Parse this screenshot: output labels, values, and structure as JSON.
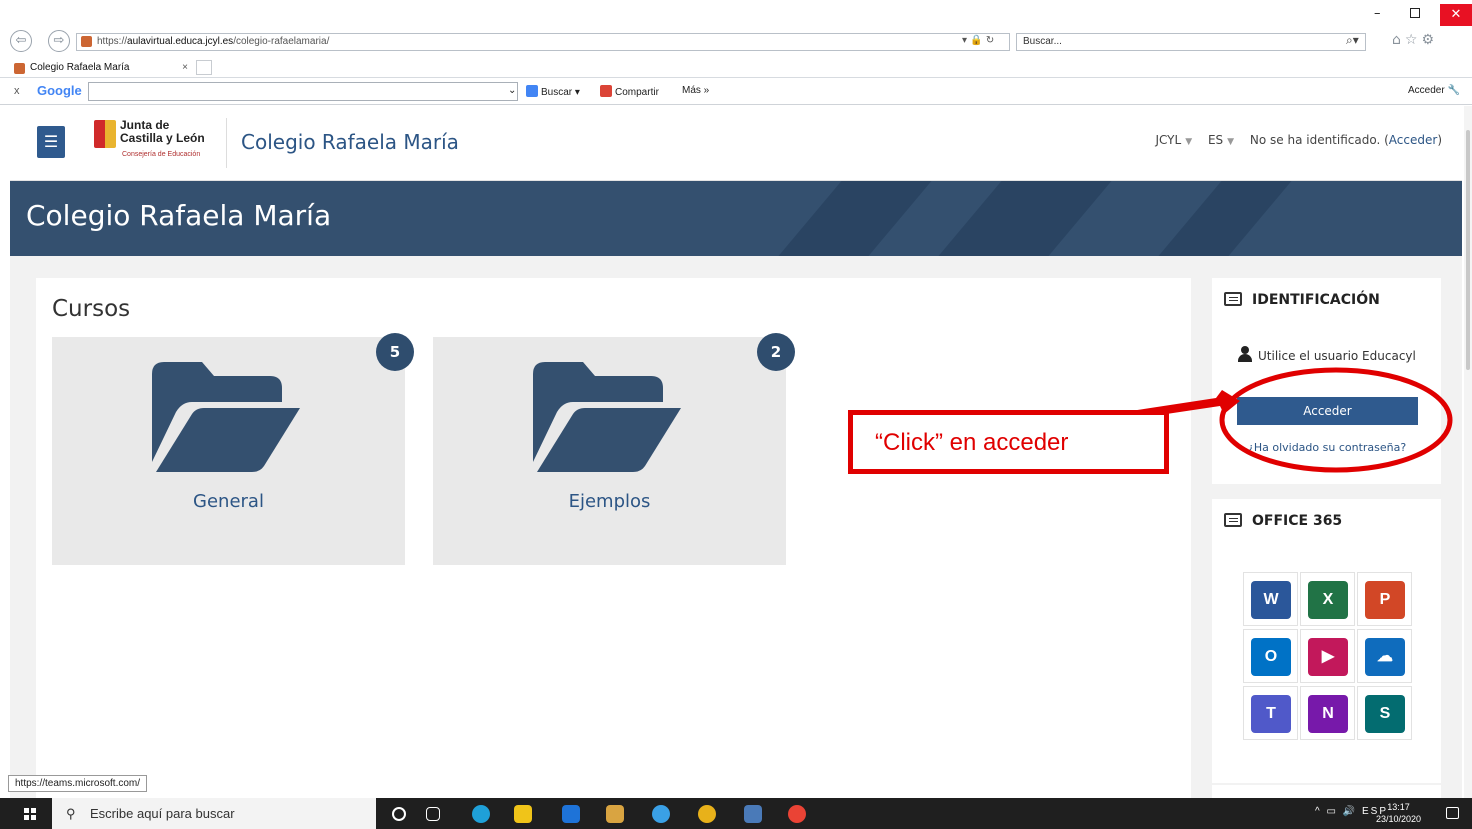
{
  "browser": {
    "url_prefix": "https://",
    "url_host": "aulavirtual.educa.jcyl.es",
    "url_path": "/colegio-rafaelamaria/",
    "search_placeholder": "Buscar...",
    "tab_title": "Colegio Rafaela María",
    "google_label": "Google",
    "buscar_label": "Buscar",
    "compartir_label": "Compartir",
    "mas_label": "Más »",
    "acceder_label": "Acceder"
  },
  "header": {
    "logo_line1": "Junta de",
    "logo_line2": "Castilla y León",
    "logo_line3": "Consejería de Educación",
    "site_name": "Colegio Rafaela María",
    "lang_menu": "JCYL",
    "lang_code": "ES",
    "login_status": "No se ha identificado. (",
    "login_link": "Acceder",
    "login_close": ")"
  },
  "banner": {
    "title": "Colegio Rafaela María"
  },
  "courses": {
    "title": "Cursos",
    "items": [
      {
        "name": "General",
        "count": "5"
      },
      {
        "name": "Ejemplos",
        "count": "2"
      }
    ]
  },
  "login_block": {
    "title": "IDENTIFICACIÓN",
    "info": "Utilice el usuario Educacyl",
    "button": "Acceder",
    "forgot": "¿Ha olvidado su contraseña?"
  },
  "office_block": {
    "title": "OFFICE 365",
    "apps": [
      {
        "letter": "W",
        "color": "#2b579a"
      },
      {
        "letter": "X",
        "color": "#217346"
      },
      {
        "letter": "P",
        "color": "#d24726"
      },
      {
        "letter": "O",
        "color": "#0072c6"
      },
      {
        "letter": "▶",
        "color": "#c2185b"
      },
      {
        "letter": "☁",
        "color": "#0f6cbd"
      },
      {
        "letter": "T",
        "color": "#5059c9"
      },
      {
        "letter": "N",
        "color": "#7719aa"
      },
      {
        "letter": "S",
        "color": "#036c70"
      }
    ]
  },
  "annotation": {
    "text": "“Click” en acceder",
    "color": "#e00000"
  },
  "status_bar": {
    "url": "https://teams.microsoft.com/"
  },
  "taskbar": {
    "search_placeholder": "Escribe aquí para buscar",
    "lang": "ESP",
    "time": "13:17",
    "date": "23/10/2020"
  },
  "colors": {
    "primary": "#2f5a8e",
    "banner": "#34506f",
    "badge": "#2f4d6e"
  }
}
